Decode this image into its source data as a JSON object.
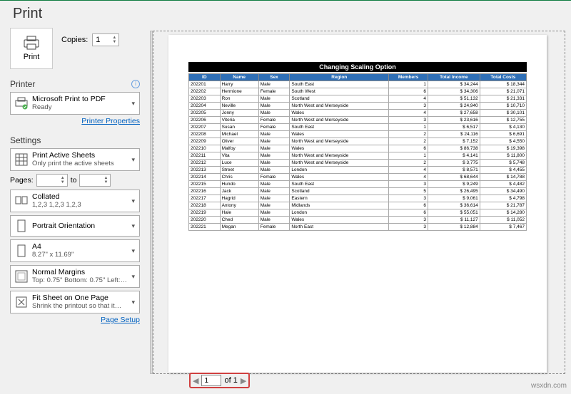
{
  "title": "Print",
  "print": {
    "button_label": "Print",
    "copies_label": "Copies:",
    "copies_value": "1"
  },
  "printer": {
    "section": "Printer",
    "name": "Microsoft Print to PDF",
    "status": "Ready",
    "props_link": "Printer Properties"
  },
  "settings": {
    "section": "Settings",
    "print_what": {
      "line1": "Print Active Sheets",
      "line2": "Only print the active sheets"
    },
    "pages_label": "Pages:",
    "pages_from": "",
    "pages_to_label": "to",
    "pages_to": "",
    "collate": {
      "line1": "Collated",
      "line2": "1,2,3    1,2,3    1,2,3"
    },
    "orientation": "Portrait Orientation",
    "paper": {
      "line1": "A4",
      "line2": "8.27\" x 11.69\""
    },
    "margins": {
      "line1": "Normal Margins",
      "line2": "Top: 0.75\" Bottom: 0.75\" Left:…"
    },
    "scaling": {
      "line1": "Fit Sheet on One Page",
      "line2": "Shrink the printout so that it…"
    },
    "page_setup_link": "Page Setup"
  },
  "pager": {
    "current": "1",
    "of_label": "of 1"
  },
  "sheet": {
    "title": "Changing Scaling Option",
    "headers": [
      "ID",
      "Name",
      "Sex",
      "Region",
      "Members",
      "Total Income",
      "Total Costs"
    ],
    "rows": [
      [
        "202201",
        "Harry",
        "Male",
        "South East",
        "1",
        "34,244",
        "18,344"
      ],
      [
        "202202",
        "Hermione",
        "Female",
        "South West",
        "6",
        "34,306",
        "21,071"
      ],
      [
        "202203",
        "Ron",
        "Male",
        "Scotland",
        "4",
        "51,132",
        "21,331"
      ],
      [
        "202204",
        "Neville",
        "Male",
        "North West and Merseyside",
        "3",
        "24,940",
        "10,710"
      ],
      [
        "202205",
        "Jonny",
        "Male",
        "Wales",
        "4",
        "27,658",
        "30,101"
      ],
      [
        "202206",
        "Vitoria",
        "Female",
        "North West and Merseyside",
        "3",
        "23,616",
        "12,755"
      ],
      [
        "202207",
        "Susan",
        "Female",
        "South East",
        "1",
        "6,517",
        "4,130"
      ],
      [
        "202208",
        "Michael",
        "Male",
        "Wales",
        "2",
        "24,116",
        "6,691"
      ],
      [
        "202209",
        "Oliver",
        "Male",
        "North West and Merseyside",
        "2",
        "7,152",
        "4,550"
      ],
      [
        "202210",
        "Malfoy",
        "Male",
        "Wales",
        "6",
        "86,738",
        "19,398"
      ],
      [
        "202211",
        "Vita",
        "Male",
        "North West and Merseyside",
        "1",
        "4,141",
        "11,800"
      ],
      [
        "202212",
        "Luce",
        "Male",
        "North West and Merseyside",
        "2",
        "3,775",
        "5,748"
      ],
      [
        "202213",
        "Street",
        "Male",
        "London",
        "4",
        "8,571",
        "4,455"
      ],
      [
        "202214",
        "Chris",
        "Female",
        "Wales",
        "4",
        "68,644",
        "14,788"
      ],
      [
        "202215",
        "Hundo",
        "Male",
        "South East",
        "3",
        "9,249",
        "4,482"
      ],
      [
        "202216",
        "Jack",
        "Male",
        "Scotland",
        "5",
        "26,495",
        "34,490"
      ],
      [
        "202217",
        "Hagrid",
        "Male",
        "Eastern",
        "3",
        "9,061",
        "4,798"
      ],
      [
        "202218",
        "Antony",
        "Male",
        "Midlands",
        "6",
        "36,614",
        "21,787"
      ],
      [
        "202219",
        "Hale",
        "Male",
        "London",
        "6",
        "55,051",
        "14,280"
      ],
      [
        "202220",
        "Ched",
        "Male",
        "Wales",
        "3",
        "11,127",
        "11,052"
      ],
      [
        "202221",
        "Megan",
        "Female",
        "North East",
        "3",
        "12,884",
        "7,467"
      ]
    ]
  },
  "watermark": "wsxdn.com"
}
